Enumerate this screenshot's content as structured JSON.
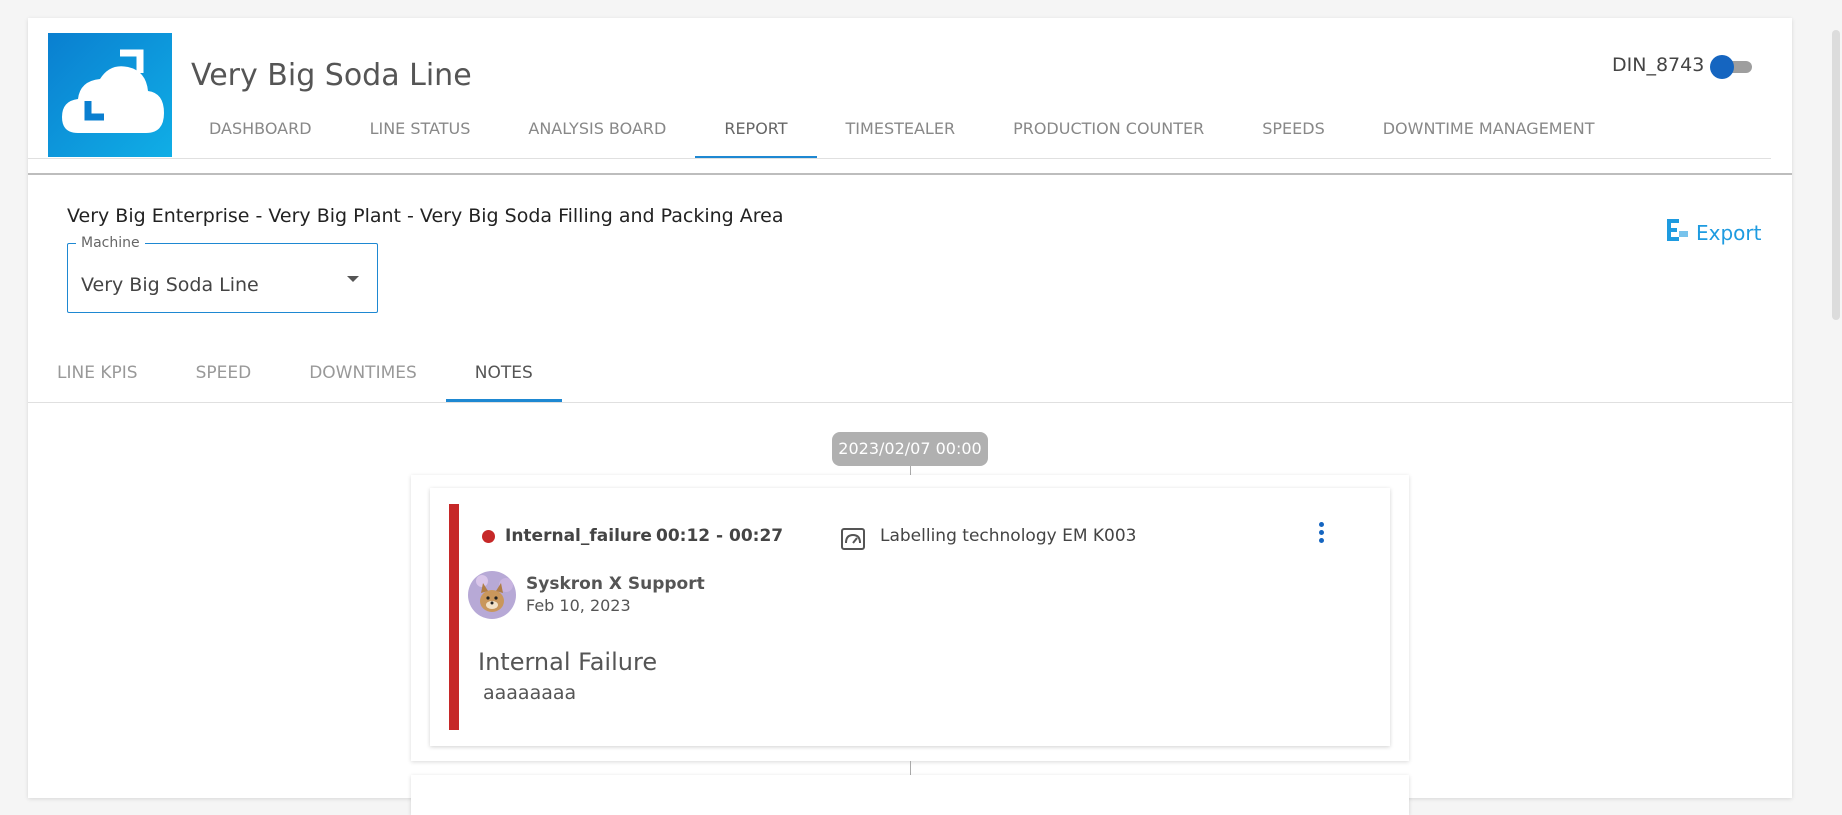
{
  "header": {
    "app_title": "Very Big Soda Line",
    "user_id": "DIN_8743",
    "toggle_on": true,
    "nav_tabs": [
      {
        "label": "DASHBOARD",
        "active": false
      },
      {
        "label": "LINE STATUS",
        "active": false
      },
      {
        "label": "ANALYSIS BOARD",
        "active": false
      },
      {
        "label": "REPORT",
        "active": true
      },
      {
        "label": "TIMESTEALER",
        "active": false
      },
      {
        "label": "PRODUCTION COUNTER",
        "active": false
      },
      {
        "label": "SPEEDS",
        "active": false
      },
      {
        "label": "DOWNTIME MANAGEMENT",
        "active": false
      }
    ]
  },
  "report": {
    "breadcrumb": "Very Big Enterprise - Very Big Plant - Very Big Soda Filling and Packing Area",
    "export_label": "Export",
    "machine_select": {
      "label": "Machine",
      "value": "Very Big Soda Line"
    },
    "sub_tabs": [
      {
        "label": "LINE KPIS",
        "active": false
      },
      {
        "label": "SPEED",
        "active": false
      },
      {
        "label": "DOWNTIMES",
        "active": false
      },
      {
        "label": "NOTES",
        "active": true
      }
    ]
  },
  "timeline": {
    "date": "2023/02/07 00:00",
    "note": {
      "reason": "Internal_failure",
      "time_range": "00:12 - 00:27",
      "machine": "Labelling technology EM K003",
      "author": "Syskron X Support",
      "author_date": "Feb 10, 2023",
      "title": "Internal Failure",
      "body": "aaaaaaaa"
    }
  },
  "colors": {
    "accent": "#1e88d2",
    "failure": "#c62828",
    "logo_bg": "#0a7fd0"
  },
  "icons": {
    "logo": "cloud-logo-icon",
    "export": "export-xls-icon",
    "machine": "gauge-icon",
    "menu": "more-vert-icon"
  }
}
